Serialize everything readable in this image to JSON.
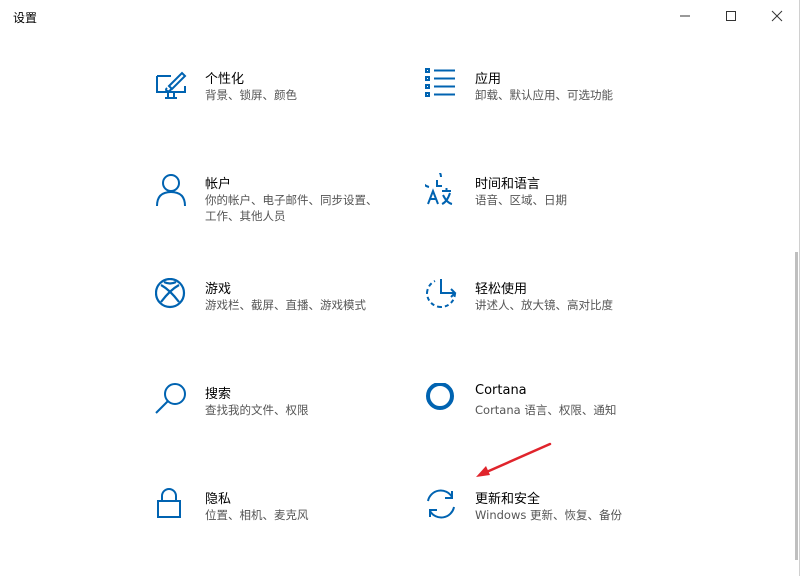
{
  "window": {
    "title": "设置"
  },
  "tiles": [
    {
      "name": "个性化",
      "desc": "背景、锁屏、颜色"
    },
    {
      "name": "应用",
      "desc": "卸载、默认应用、可选功能"
    },
    {
      "name": "帐户",
      "desc": "你的帐户、电子邮件、同步设置、工作、其他人员"
    },
    {
      "name": "时间和语言",
      "desc": "语音、区域、日期"
    },
    {
      "name": "游戏",
      "desc": "游戏栏、截屏、直播、游戏模式"
    },
    {
      "name": "轻松使用",
      "desc": "讲述人、放大镜、高对比度"
    },
    {
      "name": "搜索",
      "desc": "查找我的文件、权限"
    },
    {
      "name": "Cortana",
      "desc": "Cortana 语言、权限、通知"
    },
    {
      "name": "隐私",
      "desc": "位置、相机、麦克风"
    },
    {
      "name": "更新和安全",
      "desc": "Windows 更新、恢复、备份"
    }
  ],
  "colors": {
    "accent": "#0063b1",
    "annotation_arrow": "#e0242c"
  },
  "icons": [
    "personalization-icon",
    "apps-icon",
    "accounts-icon",
    "time-language-icon",
    "gaming-icon",
    "ease-of-access-icon",
    "search-icon",
    "cortana-icon",
    "privacy-icon",
    "update-security-icon"
  ]
}
